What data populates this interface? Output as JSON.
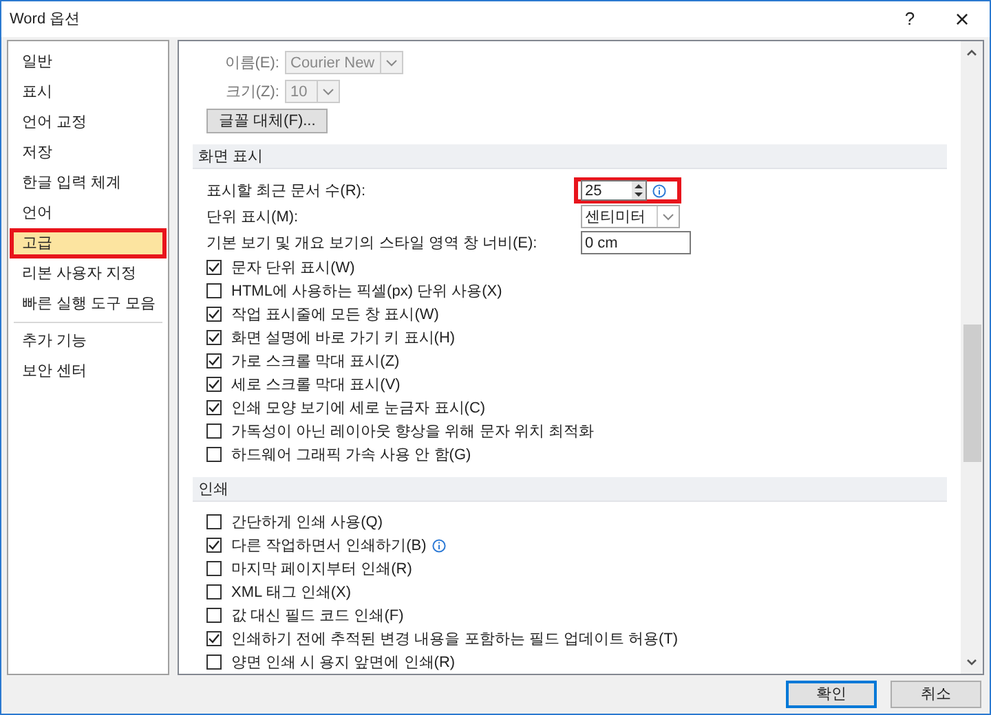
{
  "window": {
    "title": "Word 옵션",
    "help": "?",
    "close": "×"
  },
  "sidebar": {
    "groups": [
      {
        "items": [
          {
            "label": "일반",
            "selected": false,
            "highlighted": false
          },
          {
            "label": "표시",
            "selected": false,
            "highlighted": false
          },
          {
            "label": "언어 교정",
            "selected": false,
            "highlighted": false
          },
          {
            "label": "저장",
            "selected": false,
            "highlighted": false
          },
          {
            "label": "한글 입력 체계",
            "selected": false,
            "highlighted": false
          },
          {
            "label": "언어",
            "selected": false,
            "highlighted": false
          },
          {
            "label": "고급",
            "selected": true,
            "highlighted": true
          },
          {
            "label": "리본 사용자 지정",
            "selected": false,
            "highlighted": false
          },
          {
            "label": "빠른 실행 도구 모음",
            "selected": false,
            "highlighted": false
          }
        ]
      },
      {
        "items": [
          {
            "label": "추가 기능",
            "selected": false,
            "highlighted": false
          },
          {
            "label": "보안 센터",
            "selected": false,
            "highlighted": false
          }
        ]
      }
    ]
  },
  "font_settings": {
    "name_label": "이름(E):",
    "name_value": "Courier New",
    "size_label": "크기(Z):",
    "size_value": "10",
    "substitution_button": "글꼴 대체(F)..."
  },
  "sections": [
    {
      "title": "화면 표시",
      "fields": [
        {
          "kind": "spinner",
          "label": "표시할 최근 문서 수(R):",
          "value": "25",
          "highlighted": true,
          "info": true
        },
        {
          "kind": "dropdown",
          "label": "단위 표시(M):",
          "value": "센티미터"
        },
        {
          "kind": "text",
          "label": "기본 보기 및 개요 보기의 스타일 영역 창 너비(E):",
          "value": "0 cm"
        }
      ],
      "options": [
        {
          "label": "문자 단위 표시(W)",
          "checked": true,
          "info": false
        },
        {
          "label": "HTML에 사용하는 픽셀(px) 단위 사용(X)",
          "checked": false,
          "info": false
        },
        {
          "label": "작업 표시줄에 모든 창 표시(W)",
          "checked": true,
          "info": false
        },
        {
          "label": "화면 설명에 바로 가기 키 표시(H)",
          "checked": true,
          "info": false
        },
        {
          "label": "가로 스크롤 막대 표시(Z)",
          "checked": true,
          "info": false
        },
        {
          "label": "세로 스크롤 막대 표시(V)",
          "checked": true,
          "info": false
        },
        {
          "label": "인쇄 모양 보기에 세로 눈금자 표시(C)",
          "checked": true,
          "info": false
        },
        {
          "label": "가독성이 아닌 레이아웃 향상을 위해 문자 위치 최적화",
          "checked": false,
          "info": false
        },
        {
          "label": "하드웨어 그래픽 가속 사용 안 함(G)",
          "checked": false,
          "info": false
        }
      ]
    },
    {
      "title": "인쇄",
      "options": [
        {
          "label": "간단하게 인쇄 사용(Q)",
          "checked": false,
          "info": false
        },
        {
          "label": "다른 작업하면서 인쇄하기(B)",
          "checked": true,
          "info": true
        },
        {
          "label": "마지막 페이지부터 인쇄(R)",
          "checked": false,
          "info": false
        },
        {
          "label": "XML 태그 인쇄(X)",
          "checked": false,
          "info": false
        },
        {
          "label": "값 대신 필드 코드 인쇄(F)",
          "checked": false,
          "info": false
        },
        {
          "label": "인쇄하기 전에 추적된 변경 내용을 포함하는 필드 업데이트 허용(T)",
          "checked": true,
          "info": false
        },
        {
          "label": "양면 인쇄 시 용지 앞면에 인쇄(R)",
          "checked": false,
          "info": false
        }
      ]
    }
  ],
  "buttons": [
    {
      "label": "확인",
      "default": true
    },
    {
      "label": "취소",
      "default": false
    }
  ]
}
